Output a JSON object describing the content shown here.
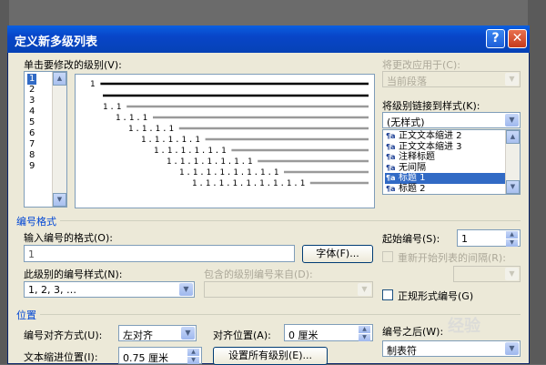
{
  "window": {
    "title": "定义新多级列表"
  },
  "levels": {
    "label": "单击要修改的级别(V):",
    "items": [
      "1",
      "2",
      "3",
      "4",
      "5",
      "6",
      "7",
      "8",
      "9"
    ],
    "selected_index": 0
  },
  "preview": {
    "lines": [
      "1",
      "1.1",
      "1.1.1",
      "1.1.1.1",
      "1.1.1.1.1",
      "1.1.1.1.1.1",
      "1.1.1.1.1.1.1",
      "1.1.1.1.1.1.1.1",
      "1.1.1.1.1.1.1.1.1"
    ]
  },
  "apply": {
    "label": "将更改应用于(C):",
    "value": "当前段落"
  },
  "link_style": {
    "label": "将级别链接到样式(K):",
    "value": "(无样式)",
    "options": [
      "正文文本缩进 2",
      "正文文本缩进 3",
      "注释标题",
      "无间隔",
      "标题 1",
      "标题 2"
    ],
    "selected_index": 4,
    "icon_glyph": "¶a"
  },
  "number_format": {
    "section_title": "编号格式",
    "format_label": "输入编号的格式(O):",
    "format_value": "1",
    "font_button": "字体(F)...",
    "style_label": "此级别的编号样式(N):",
    "style_value": "1, 2, 3, …",
    "include_label": "包含的级别编号来自(D):",
    "start_label": "起始编号(S):",
    "start_value": "1",
    "restart_label": "重新开始列表的间隔(R):",
    "legal_label": "正规形式编号(G)"
  },
  "position": {
    "section_title": "位置",
    "align_label": "编号对齐方式(U):",
    "align_value": "左对齐",
    "align_at_label": "对齐位置(A):",
    "align_at_value": "0 厘米",
    "indent_label": "文本缩进位置(I):",
    "indent_value": "0.75 厘米",
    "set_all_button": "设置所有级别(E)...",
    "follow_label": "编号之后(W):",
    "follow_value": "制表符"
  },
  "watermark": "经验"
}
